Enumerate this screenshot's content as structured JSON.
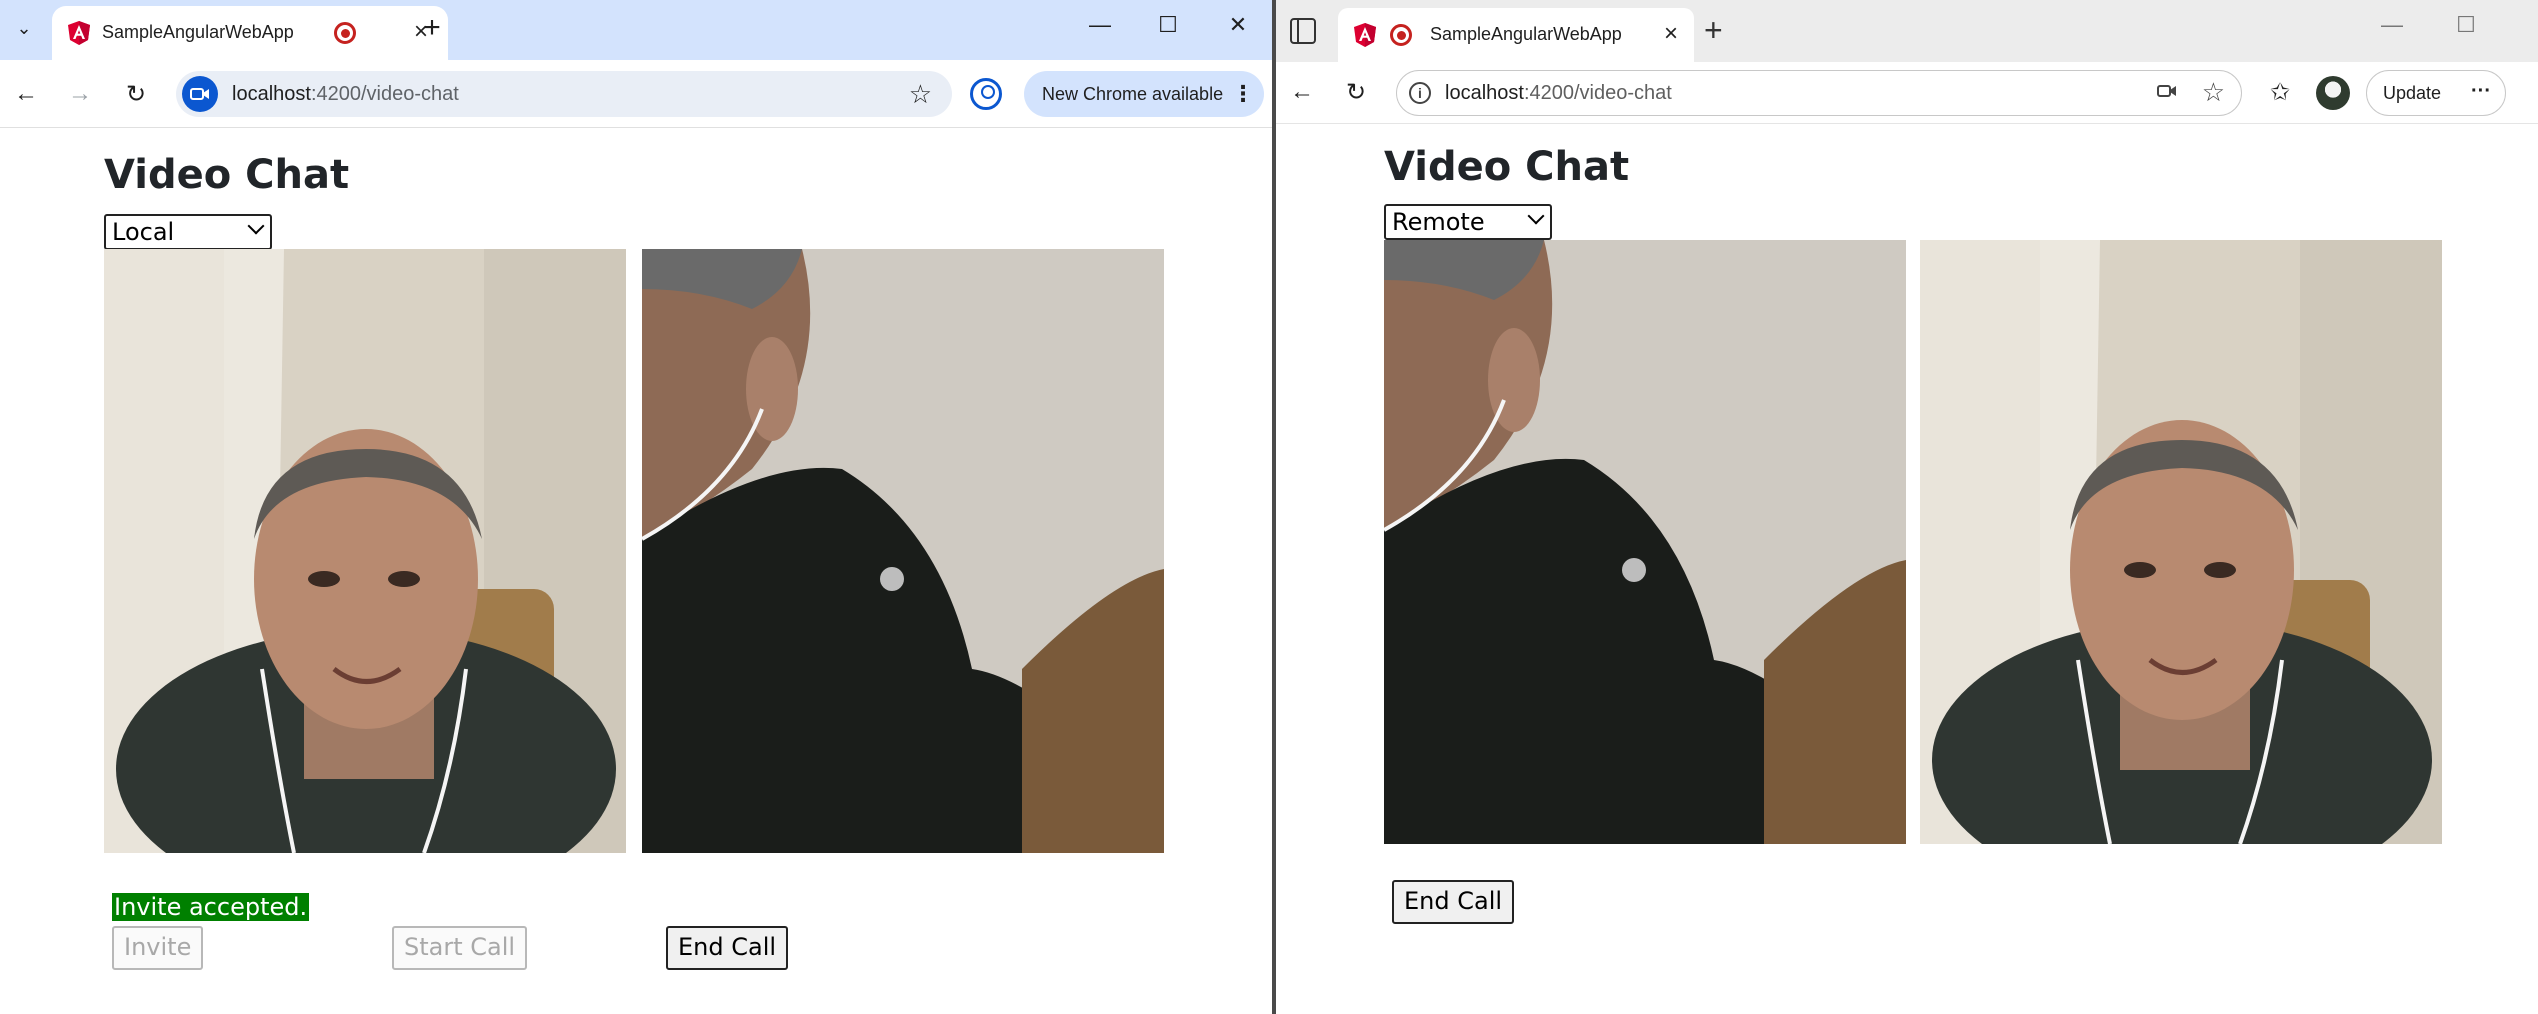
{
  "left_window": {
    "tab_title": "SampleAngularWebApp",
    "url_host": "localhost",
    "url_path": ":4200/video-chat",
    "update_label": "New Chrome available",
    "page": {
      "title": "Video Chat",
      "mode_selected": "Local",
      "status_message": "Invite accepted.",
      "buttons": {
        "invite": "Invite",
        "start_call": "Start Call",
        "end_call": "End Call"
      }
    }
  },
  "right_window": {
    "tab_title": "SampleAngularWebApp",
    "url_host": "localhost",
    "url_path": ":4200/video-chat",
    "update_label": "Update",
    "page": {
      "title": "Video Chat",
      "mode_selected": "Remote",
      "buttons": {
        "end_call": "End Call"
      }
    }
  },
  "icons": {
    "tab_search": "chevron-down-icon",
    "back": "arrow-left-icon",
    "forward": "arrow-right-icon",
    "reload": "reload-icon",
    "star": "star-icon",
    "minimize": "minimize-icon",
    "maximize": "maximize-icon",
    "close": "close-icon"
  },
  "colors": {
    "chrome_tabstrip": "#d3e3fd",
    "status_green": "#008000",
    "recording_red": "#c5221f"
  }
}
